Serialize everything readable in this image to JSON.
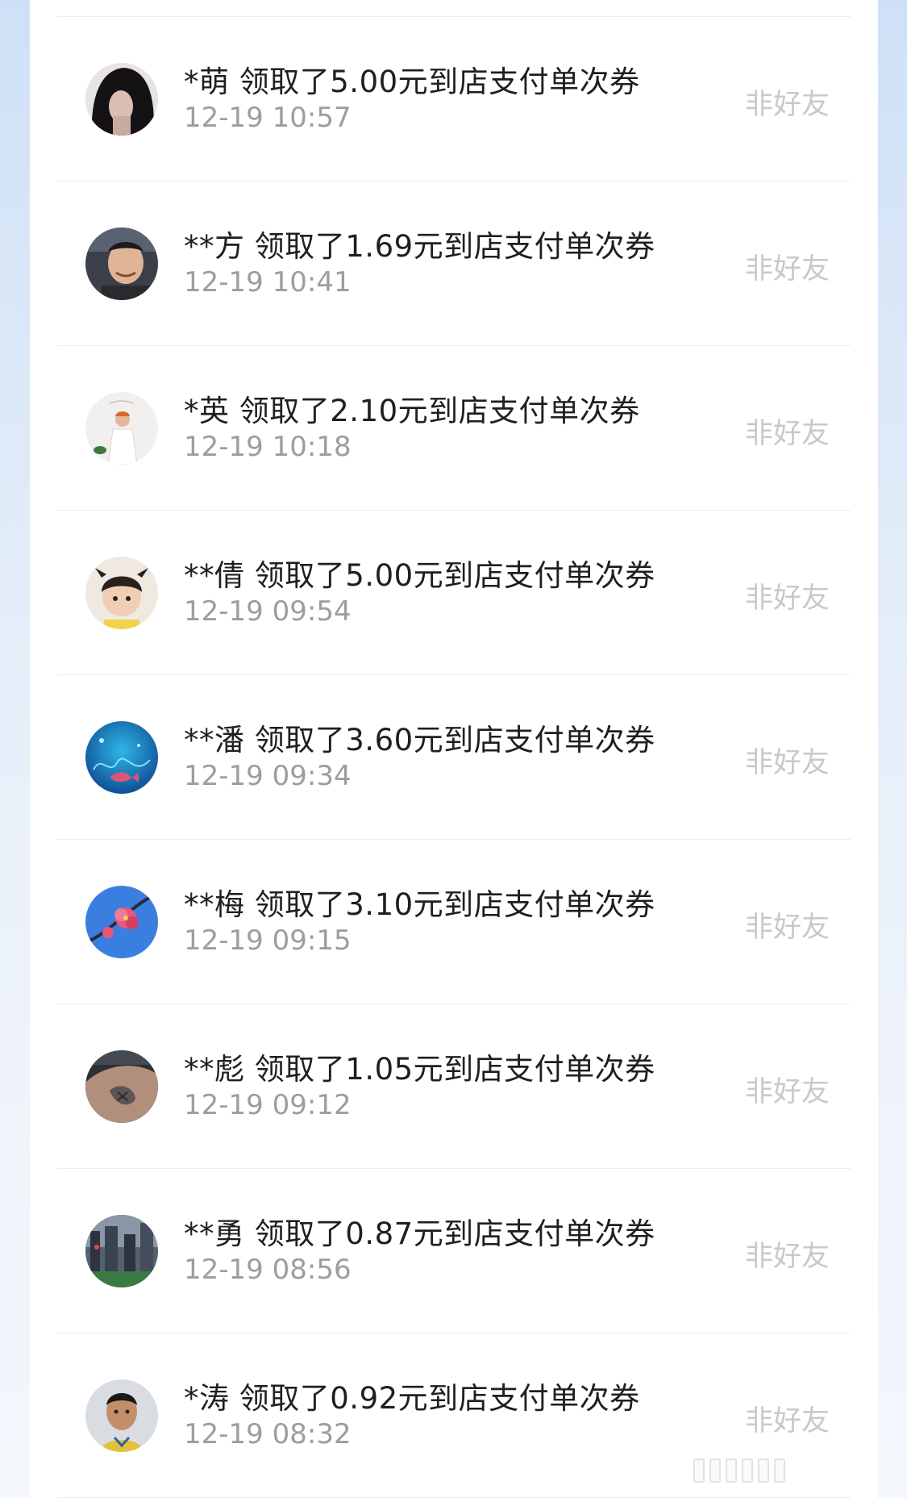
{
  "records": [
    {
      "name": "*萌",
      "text": "领取了5.00元到店支付单次券",
      "time": "12-19 10:57",
      "tag": "非好友",
      "avatar": "avatar-person-dark-hair"
    },
    {
      "name": "**方",
      "text": "领取了1.69元到店支付单次券",
      "time": "12-19 10:41",
      "tag": "非好友",
      "avatar": "avatar-man-smiling"
    },
    {
      "name": "*英",
      "text": "领取了2.10元到店支付单次券",
      "time": "12-19 10:18",
      "tag": "非好友",
      "avatar": "avatar-woman-white-dress"
    },
    {
      "name": "**倩",
      "text": "领取了5.00元到店支付单次券",
      "time": "12-19 09:54",
      "tag": "非好友",
      "avatar": "avatar-baby"
    },
    {
      "name": "**潘",
      "text": "领取了3.60元到店支付单次券",
      "time": "12-19 09:34",
      "tag": "非好友",
      "avatar": "avatar-fish-blue"
    },
    {
      "name": "**梅",
      "text": "领取了3.10元到店支付单次券",
      "time": "12-19 09:15",
      "tag": "非好友",
      "avatar": "avatar-plum-blossom"
    },
    {
      "name": "**彪",
      "text": "领取了1.05元到店支付单次券",
      "time": "12-19 09:12",
      "tag": "非好友",
      "avatar": "avatar-tattoo-arm"
    },
    {
      "name": "**勇",
      "text": "领取了0.87元到店支付单次券",
      "time": "12-19 08:56",
      "tag": "非好友",
      "avatar": "avatar-city-street"
    },
    {
      "name": "*涛",
      "text": "领取了0.92元到店支付单次券",
      "time": "12-19 08:32",
      "tag": "非好友",
      "avatar": "avatar-young-man"
    }
  ]
}
